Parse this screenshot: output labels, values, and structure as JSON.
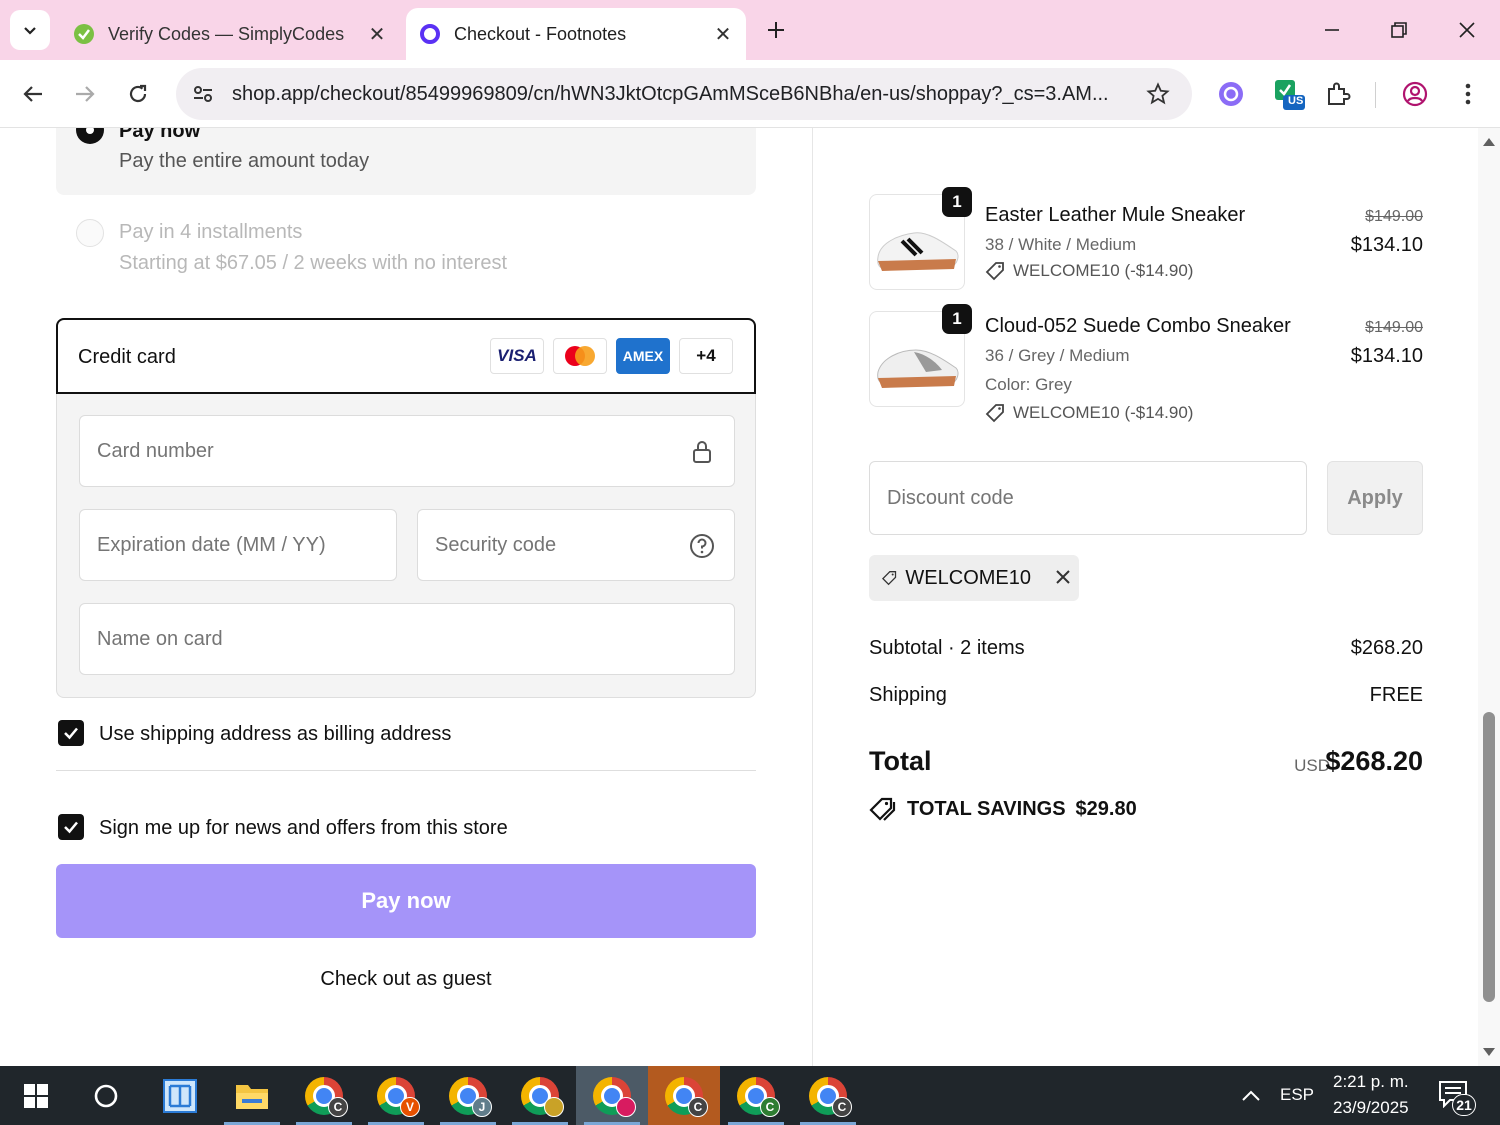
{
  "browser": {
    "tabs": [
      {
        "title": "Verify Codes — SimplyCodes",
        "close": "✕"
      },
      {
        "title": "Checkout - Footnotes",
        "close": "✕"
      }
    ],
    "new_tab": "+",
    "url": "shop.app/checkout/85499969809/cn/hWN3JktOtcpGAmMSceB6NBha/en-us/shoppay?_cs=3.AM...",
    "ext_badge": "US"
  },
  "payment": {
    "paynow_title": "Pay now",
    "paynow_sub": "Pay the entire amount today",
    "installments_title": "Pay in 4 installments",
    "installments_sub": "Starting at $67.05 / 2 weeks with no interest",
    "credit_card_title": "Credit card",
    "card_brands": {
      "visa": "VISA",
      "amex": "AMEX",
      "more": "+4"
    },
    "card_number_ph": "Card number",
    "expiration_ph": "Expiration date (MM / YY)",
    "security_ph": "Security code",
    "name_ph": "Name on card",
    "billing_label": "Use shipping address as billing address",
    "news_label": "Sign me up for news and offers from this store",
    "pay_button": "Pay now",
    "guest_link": "Check out as guest"
  },
  "order": {
    "items": [
      {
        "qty": "1",
        "name": "Easter Leather Mule Sneaker",
        "variant": "38 / White / Medium",
        "color": "",
        "discount": "WELCOME10 (-$14.90)",
        "old_price": "$149.00",
        "price": "$134.10"
      },
      {
        "qty": "1",
        "name": "Cloud-052 Suede Combo Sneaker",
        "variant": "36 / Grey / Medium",
        "color": "Color: Grey",
        "discount": "WELCOME10 (-$14.90)",
        "old_price": "$149.00",
        "price": "$134.10"
      }
    ],
    "discount_ph": "Discount code",
    "apply": "Apply",
    "applied_code": "WELCOME10",
    "subtotal_label": "Subtotal · 2 items",
    "subtotal": "$268.20",
    "shipping_label": "Shipping",
    "shipping": "FREE",
    "total_label": "Total",
    "currency": "USD",
    "total": "$268.20",
    "savings_label": "TOTAL SAVINGS",
    "savings": "$29.80"
  },
  "taskbar": {
    "badges": [
      "C",
      "V",
      "J",
      "",
      "",
      "C",
      "C",
      "C"
    ],
    "lang": "ESP",
    "time": "2:21 p. m.",
    "date": "23/9/2025",
    "notifications": "21"
  },
  "colors": {
    "tabbar": "#f9d5e8",
    "pay_button": "#a594f9",
    "taskbar": "#20262b"
  }
}
